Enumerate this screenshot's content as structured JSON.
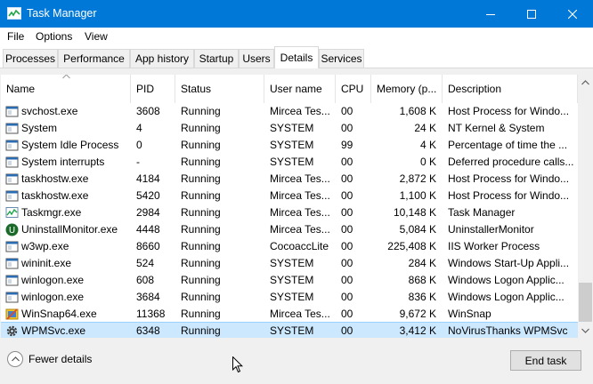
{
  "window": {
    "title": "Task Manager"
  },
  "menu": [
    "File",
    "Options",
    "View"
  ],
  "tabs": [
    "Processes",
    "Performance",
    "App history",
    "Startup",
    "Users",
    "Details",
    "Services"
  ],
  "active_tab": "Details",
  "columns": [
    "Name",
    "PID",
    "Status",
    "User name",
    "CPU",
    "Memory (p...",
    "Description"
  ],
  "sort_column": "Name",
  "rows": [
    {
      "icon": "generic-process-icon",
      "name": "svchost.exe",
      "pid": "3608",
      "status": "Running",
      "user": "Mircea Tes...",
      "cpu": "00",
      "mem": "1,608 K",
      "desc": "Host Process for Windo..."
    },
    {
      "icon": "generic-process-icon",
      "name": "System",
      "pid": "4",
      "status": "Running",
      "user": "SYSTEM",
      "cpu": "00",
      "mem": "24 K",
      "desc": "NT Kernel & System"
    },
    {
      "icon": "generic-process-icon",
      "name": "System Idle Process",
      "pid": "0",
      "status": "Running",
      "user": "SYSTEM",
      "cpu": "99",
      "mem": "4 K",
      "desc": "Percentage of time the ..."
    },
    {
      "icon": "generic-process-icon",
      "name": "System interrupts",
      "pid": "-",
      "status": "Running",
      "user": "SYSTEM",
      "cpu": "00",
      "mem": "0 K",
      "desc": "Deferred procedure calls..."
    },
    {
      "icon": "generic-process-icon",
      "name": "taskhostw.exe",
      "pid": "4184",
      "status": "Running",
      "user": "Mircea Tes...",
      "cpu": "00",
      "mem": "2,872 K",
      "desc": "Host Process for Windo..."
    },
    {
      "icon": "generic-process-icon",
      "name": "taskhostw.exe",
      "pid": "5420",
      "status": "Running",
      "user": "Mircea Tes...",
      "cpu": "00",
      "mem": "1,100 K",
      "desc": "Host Process for Windo..."
    },
    {
      "icon": "taskmgr-icon",
      "name": "Taskmgr.exe",
      "pid": "2984",
      "status": "Running",
      "user": "Mircea Tes...",
      "cpu": "00",
      "mem": "10,148 K",
      "desc": "Task Manager"
    },
    {
      "icon": "uninstall-monitor-icon",
      "name": "UninstallMonitor.exe",
      "pid": "4448",
      "status": "Running",
      "user": "Mircea Tes...",
      "cpu": "00",
      "mem": "5,084 K",
      "desc": "UninstallerMonitor"
    },
    {
      "icon": "generic-process-icon",
      "name": "w3wp.exe",
      "pid": "8660",
      "status": "Running",
      "user": "CocoaccLite",
      "cpu": "00",
      "mem": "225,408 K",
      "desc": "IIS Worker Process"
    },
    {
      "icon": "generic-process-icon",
      "name": "wininit.exe",
      "pid": "524",
      "status": "Running",
      "user": "SYSTEM",
      "cpu": "00",
      "mem": "284 K",
      "desc": "Windows Start-Up Appli..."
    },
    {
      "icon": "generic-process-icon",
      "name": "winlogon.exe",
      "pid": "608",
      "status": "Running",
      "user": "SYSTEM",
      "cpu": "00",
      "mem": "868 K",
      "desc": "Windows Logon Applic..."
    },
    {
      "icon": "generic-process-icon",
      "name": "winlogon.exe",
      "pid": "3684",
      "status": "Running",
      "user": "SYSTEM",
      "cpu": "00",
      "mem": "836 K",
      "desc": "Windows Logon Applic..."
    },
    {
      "icon": "winsnap-icon",
      "name": "WinSnap64.exe",
      "pid": "11368",
      "status": "Running",
      "user": "Mircea Tes...",
      "cpu": "00",
      "mem": "9,672 K",
      "desc": "WinSnap"
    },
    {
      "icon": "gear-icon",
      "name": "WPMSvc.exe",
      "pid": "6348",
      "status": "Running",
      "user": "SYSTEM",
      "cpu": "00",
      "mem": "3,412 K",
      "desc": "NoVirusThanks WPMSvc",
      "selected": true
    }
  ],
  "footer": {
    "fewer_details": "Fewer details",
    "end_task": "End task"
  },
  "colors": {
    "titlebar": "#0078d7",
    "selection": "#cce8ff",
    "selection_border": "#99d1ff"
  }
}
